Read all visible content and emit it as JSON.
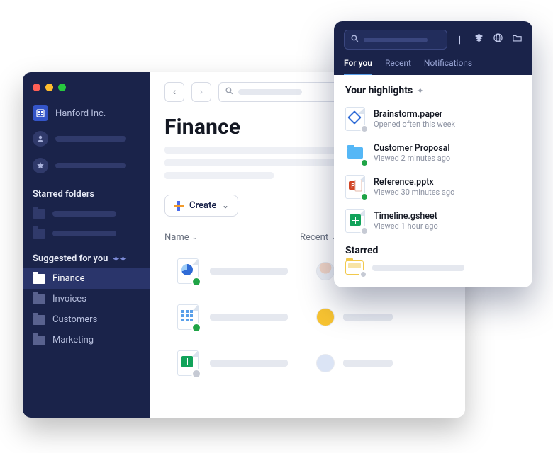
{
  "sidebar": {
    "org_name": "Hanford Inc.",
    "sections": {
      "starred": "Starred folders",
      "suggested": "Suggested for you"
    },
    "suggested_items": [
      {
        "label": "Finance",
        "active": true
      },
      {
        "label": "Invoices",
        "active": false
      },
      {
        "label": "Customers",
        "active": false
      },
      {
        "label": "Marketing",
        "active": false
      }
    ]
  },
  "main": {
    "title": "Finance",
    "create_label": "Create",
    "columns": {
      "name": "Name",
      "recent": "Recent"
    }
  },
  "popover": {
    "tabs": [
      {
        "label": "For you",
        "active": true
      },
      {
        "label": "Recent",
        "active": false
      },
      {
        "label": "Notifications",
        "active": false
      }
    ],
    "highlights_title": "Your highlights",
    "highlights": [
      {
        "name": "Brainstorm.paper",
        "meta": "Opened often this week",
        "type": "paper",
        "badge": "gray"
      },
      {
        "name": "Customer Proposal",
        "meta": "Viewed 2 minutes ago",
        "type": "folder",
        "badge": "ok"
      },
      {
        "name": "Reference.pptx",
        "meta": "Viewed 30 minutes ago",
        "type": "ppt",
        "badge": "ok"
      },
      {
        "name": "Timeline.gsheet",
        "meta": "Viewed 1 hour ago",
        "type": "gsheet",
        "badge": "gray"
      }
    ],
    "starred_title": "Starred"
  }
}
